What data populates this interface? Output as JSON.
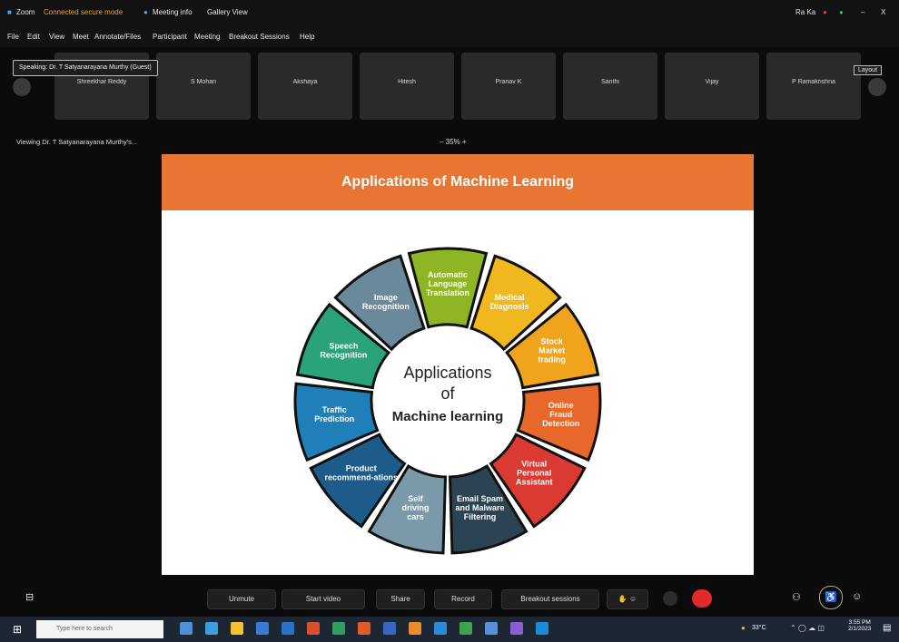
{
  "titlebar": {
    "app": "Zoom",
    "status": "Connected secure mode",
    "meeting_info": "Meeting info",
    "view": "Gallery View",
    "minimize": "–",
    "close": "X"
  },
  "menubar": [
    "File",
    "Edit",
    "View",
    "Meet",
    "Annotate/Files",
    "Participant",
    "Meeting",
    "Breakout Sessions",
    "Help"
  ],
  "viewing_badge": "Speaking: Dr. T Satyanarayana Murthy (Guest)",
  "participants": [
    "Shreekhar Reddy",
    "S Mohan",
    "Akshaya",
    "Hitesh",
    "Pranav K",
    "Santhi",
    "Vijay",
    "P Ramakrishna"
  ],
  "viewing_label": "Viewing Dr. T Satyanarayana Murthy's...",
  "zoom_level": "35%",
  "layout_button": "Layout",
  "slide": {
    "title": "Applications of Machine Learning",
    "center": [
      "Applications",
      "of",
      "Machine learning"
    ],
    "segments": [
      {
        "label": "Automatic Language Translation",
        "color": "#8db524"
      },
      {
        "label": "Medical Diagnosis",
        "color": "#f0b81e"
      },
      {
        "label": "Stock Market trading",
        "color": "#f0a31c"
      },
      {
        "label": "Online Fraud Detection",
        "color": "#e8672b"
      },
      {
        "label": "Virtual Personal Assistant",
        "color": "#db3a32"
      },
      {
        "label": "Email Spam and Malware Filtering",
        "color": "#2c4354"
      },
      {
        "label": "Self driving cars",
        "color": "#7a9aaa"
      },
      {
        "label": "Product recommend-ations",
        "color": "#1d5b8a"
      },
      {
        "label": "Traffic Prediction",
        "color": "#1f7fb8"
      },
      {
        "label": "Speech Recognition",
        "color": "#2aa37b"
      },
      {
        "label": "Image Recognition",
        "color": "#6a8a9c"
      }
    ]
  },
  "toolbar": {
    "unmute": "Unmute",
    "start_video": "Start video",
    "share": "Share",
    "record": "Record",
    "breakout": "Breakout sessions"
  },
  "taskbar": {
    "search_placeholder": "Type here to search",
    "temperature": "33°C",
    "time": "3:55 PM",
    "date": "2/1/2023"
  }
}
